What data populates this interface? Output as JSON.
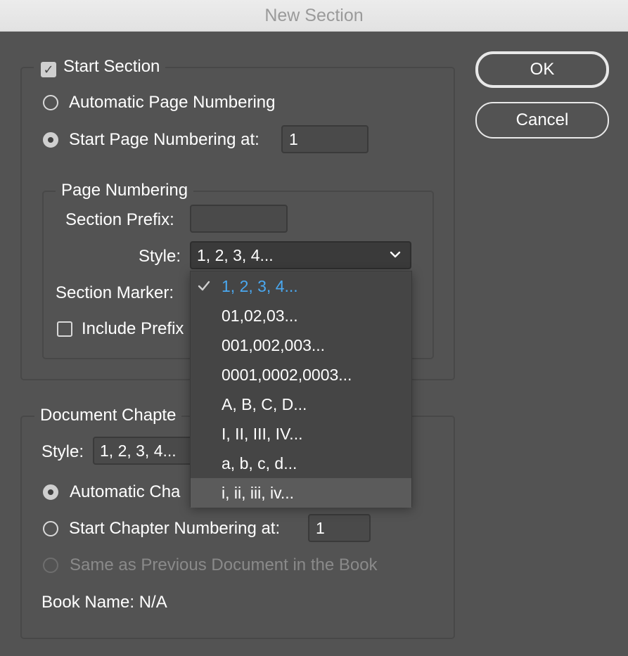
{
  "window": {
    "title": "New Section"
  },
  "buttons": {
    "ok": "OK",
    "cancel": "Cancel"
  },
  "start_section": {
    "label": "Start Section",
    "checked": true,
    "auto_page_numbering": "Automatic Page Numbering",
    "start_page_numbering": "Start Page Numbering at:",
    "start_page_value": "1",
    "selected_option": "start_page_numbering"
  },
  "page_numbering": {
    "legend": "Page Numbering",
    "section_prefix_label": "Section Prefix:",
    "section_prefix_value": "",
    "style_label": "Style:",
    "style_value": "1, 2, 3, 4...",
    "section_marker_label": "Section Marker:",
    "include_prefix_label": "Include Prefix"
  },
  "style_dropdown": {
    "options": [
      "1, 2, 3, 4...",
      "01,02,03...",
      "001,002,003...",
      "0001,0002,0003...",
      "A, B, C, D...",
      "I, II, III, IV...",
      "a, b, c, d...",
      "i, ii, iii, iv..."
    ],
    "selected_index": 0,
    "hover_index": 7
  },
  "document_chapter": {
    "legend": "Document Chapte",
    "style_label": "Style:",
    "style_value": "1, 2, 3, 4...",
    "auto_chapter_label": "Automatic Cha",
    "start_chapter_label": "Start Chapter Numbering at:",
    "start_chapter_value": "1",
    "same_as_previous_label": "Same as Previous Document in the Book",
    "book_name": "Book Name: N/A"
  },
  "colors": {
    "background": "#535353",
    "accent_text": "#4aa8f0"
  }
}
